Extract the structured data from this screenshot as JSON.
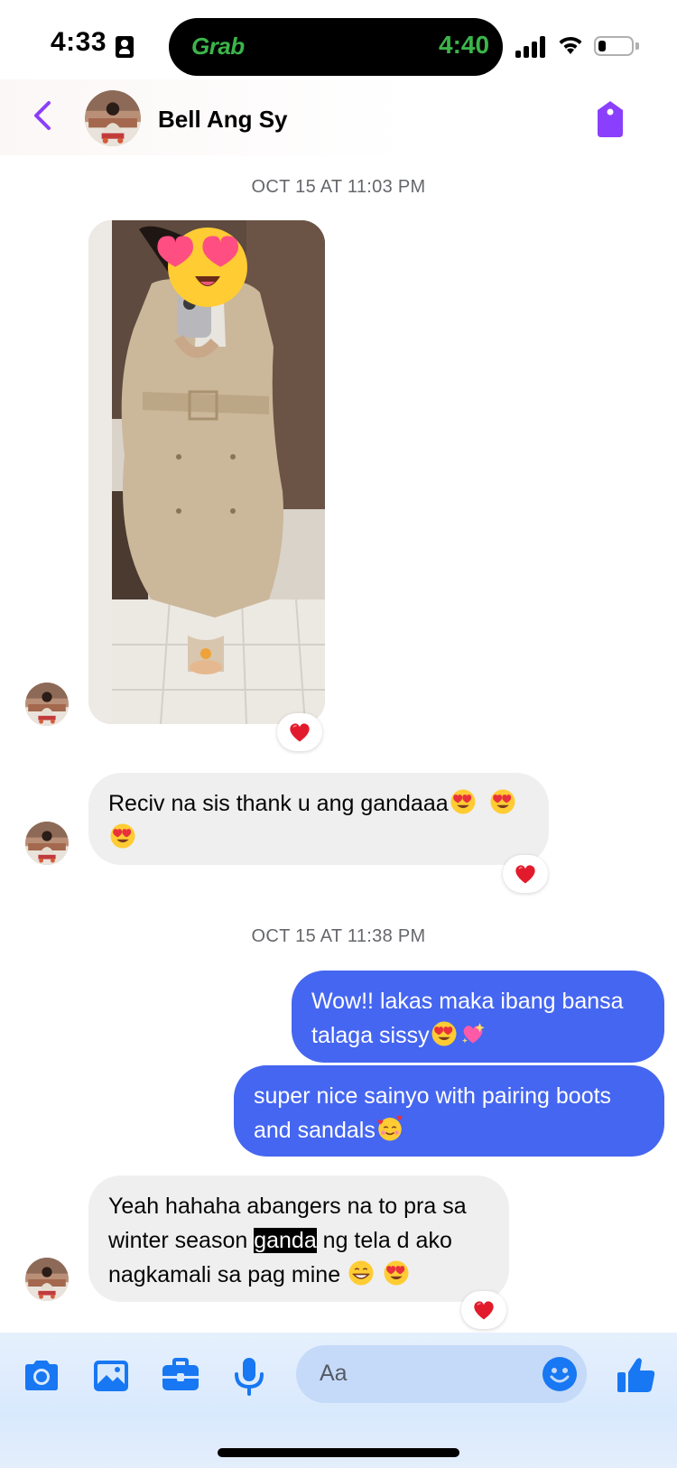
{
  "status_bar": {
    "time": "4:33",
    "island_app": "Grab",
    "island_time": "4:40"
  },
  "header": {
    "contact_name": "Bell Ang Sy"
  },
  "thread": {
    "timestamp_1": "OCT 15 AT 11:03 PM",
    "timestamp_2": "OCT 15 AT 11:38 PM",
    "msg1_text": "Reciv na sis thank u ang gandaaa",
    "msg2_text": "Wow!! lakas maka ibang bansa talaga sissy",
    "msg3_text": "super nice sainyo with pairing boots and sandals",
    "msg4_part1": "Yeah hahaha abangers na to pra sa winter season ",
    "msg4_highlight": "ganda",
    "msg4_part2": " ng tela d ako nagkamali sa pag mine ",
    "reaction": "heart"
  },
  "composer": {
    "placeholder": "Aa"
  },
  "colors": {
    "accent": "#8a3ffc",
    "outgoing_bubble": "#4566f0",
    "incoming_bubble": "#efefef",
    "composer_icons": "#1877f2"
  },
  "icons": [
    "back-icon",
    "tag-icon",
    "camera-icon",
    "image-icon",
    "briefcase-icon",
    "microphone-icon",
    "emoji-icon",
    "thumbs-up-icon",
    "heart-eyes-icon",
    "sparkle-heart-icon",
    "smiling-hearts-icon",
    "grin-icon"
  ]
}
